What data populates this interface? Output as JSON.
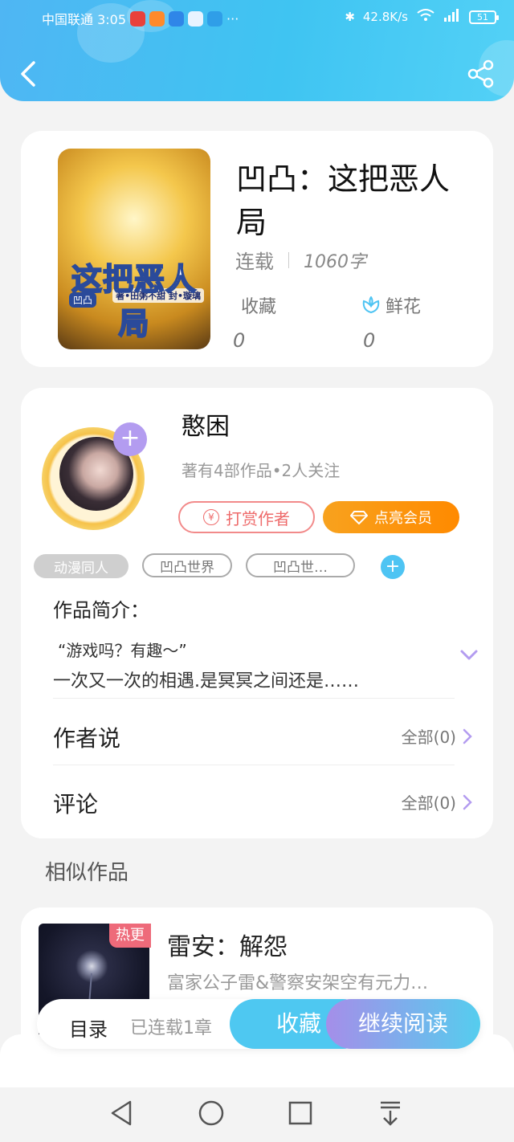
{
  "status_bar": {
    "carrier_time": "中国联通 3:05",
    "overflow": "···",
    "speed": "42.8K/s",
    "battery": "51"
  },
  "book": {
    "cover_title": "这把恶人局",
    "cover_tag": "凹凸",
    "cover_credit": "著•田粥不甜 封•璇璃",
    "title": "凹凸：这把恶人局",
    "status": "连载",
    "word_count": "1060字",
    "favorites_label": "收藏",
    "favorites_value": "0",
    "flowers_label": "鲜花",
    "flowers_value": "0"
  },
  "author": {
    "name": "憨困",
    "meta": "著有4部作品•2人关注",
    "reward_label": "打赏作者",
    "vip_label": "点亮会员"
  },
  "tags": [
    "动漫同人",
    "凹凸世界",
    "凹凸世…"
  ],
  "intro": {
    "label": "作品简介：",
    "line1": "“游戏吗？有趣～”",
    "line2": "一次又一次的相遇.是冥冥之间还是……"
  },
  "rows": {
    "author_says_label": "作者说",
    "author_says_value": "全部(0)",
    "comments_label": "评论",
    "comments_value": "全部(0)"
  },
  "similar": {
    "heading": "相似作品",
    "items": [
      {
        "badge": "热更",
        "title": "雷安：解怨",
        "desc": "富家公子雷&警察安架空有元力…"
      }
    ]
  },
  "action_bar": {
    "toc_label": "目录",
    "serial_info": "已连载1章",
    "collect_label": "收藏",
    "read_label": "继续阅读"
  },
  "colors": {
    "header_blue": "#4fb6f3",
    "accent_cyan": "#4ec8f1",
    "vip_orange": "#ff8a00",
    "reward_red": "#ee6b6b",
    "hot_pink": "#ee6a7a",
    "purple": "#b39cf0"
  },
  "icons": [
    "back-icon",
    "share-icon",
    "flower-icon",
    "plus-icon",
    "yen-icon",
    "diamond-icon",
    "chevron-down-icon",
    "chevron-right-icon",
    "nav-back-icon",
    "nav-home-icon",
    "nav-recents-icon",
    "nav-download-icon"
  ]
}
